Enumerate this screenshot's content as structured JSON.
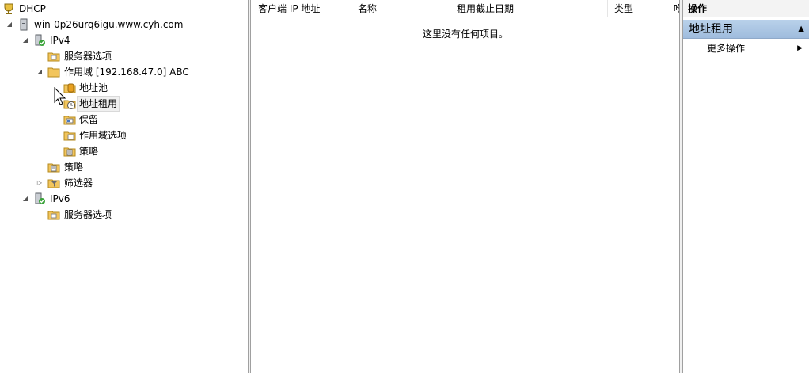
{
  "tree": {
    "root": "DHCP",
    "server": "win-0p26urq6igu.www.cyh.com",
    "ipv4": {
      "label": "IPv4",
      "server_options": "服务器选项",
      "scope": {
        "label": "作用域 [192.168.47.0] ABC",
        "pool": "地址池",
        "leases": "地址租用",
        "reservations": "保留",
        "scope_options": "作用域选项",
        "policies": "策略"
      },
      "policies": "策略",
      "filters": "筛选器"
    },
    "ipv6": {
      "label": "IPv6",
      "server_options": "服务器选项"
    }
  },
  "list": {
    "columns": [
      "客户端 IP 地址",
      "名称",
      "租用截止日期",
      "类型",
      "唯"
    ],
    "empty_message": "这里没有任何项目。"
  },
  "actions": {
    "title": "操作",
    "section": "地址租用",
    "more": "更多操作"
  },
  "colors": {
    "section_bg": "#b9d1ea",
    "folder": "#f2c55c",
    "server_green": "#3aa33a"
  }
}
